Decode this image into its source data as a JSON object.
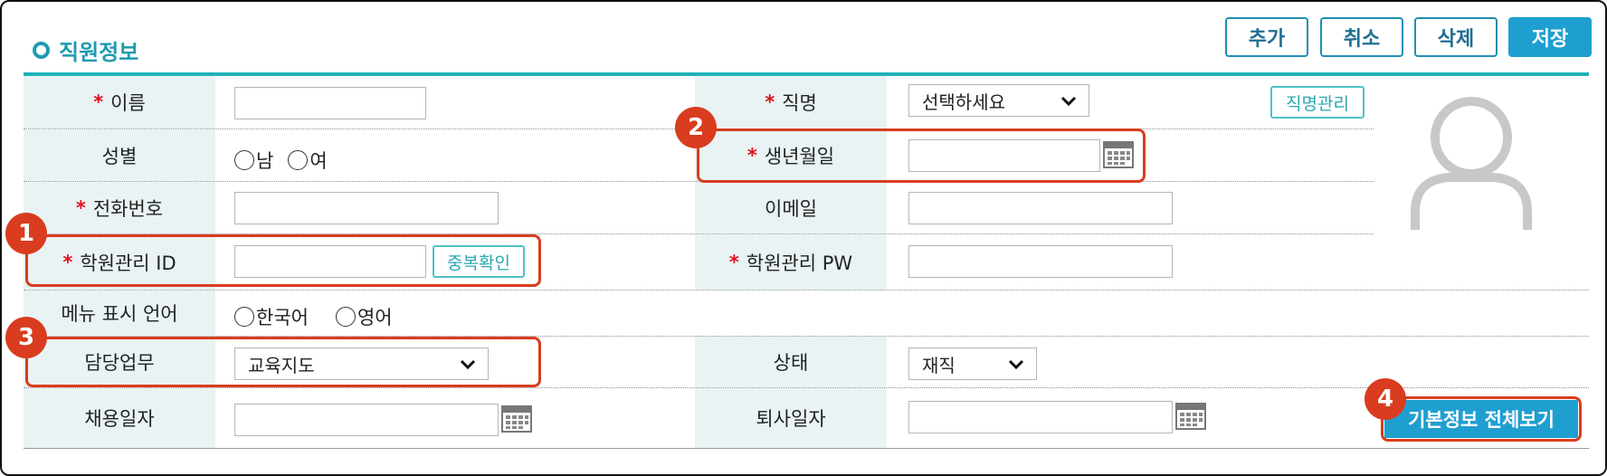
{
  "header": {
    "title": "직원정보",
    "buttons": {
      "add": "추가",
      "cancel": "취소",
      "delete": "삭제",
      "save": "저장"
    }
  },
  "form": {
    "name_label": "이름",
    "name_value": "",
    "gender_label": "성별",
    "gender_options": [
      "남",
      "여"
    ],
    "phone_label": "전화번호",
    "phone_value": "",
    "academy_id_label": "학원관리 ID",
    "academy_id_value": "",
    "duplicate_check_label": "중복확인",
    "menu_language_label": "메뉴 표시 언어",
    "language_options": [
      "한국어",
      "영어"
    ],
    "duty_label": "담당업무",
    "duty_value": "교육지도",
    "hire_date_label": "채용일자",
    "hire_date_value": "",
    "position_label": "직명",
    "position_value": "선택하세요",
    "position_manage_label": "직명관리",
    "birth_date_label": "생년월일",
    "birth_date_value": "",
    "email_label": "이메일",
    "email_value": "",
    "academy_pw_label": "학원관리 PW",
    "academy_pw_value": "",
    "status_label": "상태",
    "status_value": "재직",
    "resign_date_label": "퇴사일자",
    "resign_date_value": "",
    "required_mark": "*"
  },
  "view_all_button": "기본정보 전체보기",
  "badges": [
    "1",
    "2",
    "3",
    "4"
  ],
  "colors": {
    "accent": "#1e9bb0",
    "button": "#1f9fd0",
    "highlight": "#d93c1f",
    "label_bg": "#e9f3f4",
    "required": "#e1111f"
  }
}
